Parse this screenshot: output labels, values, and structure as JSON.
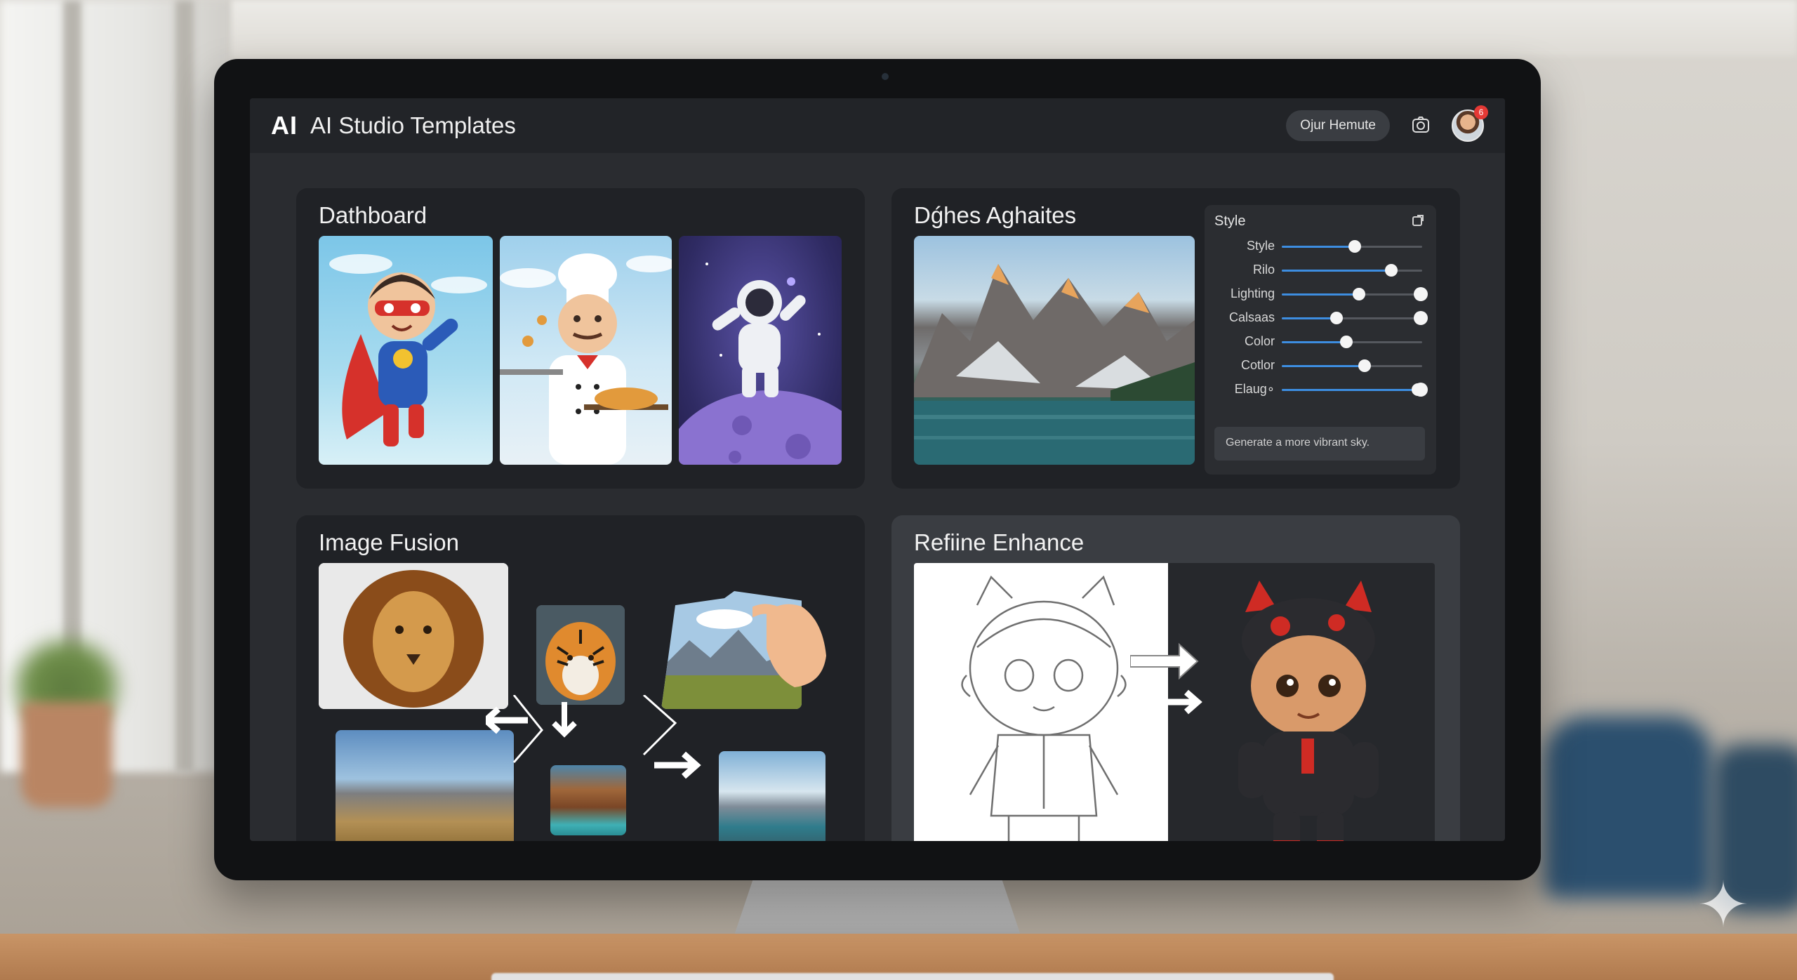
{
  "header": {
    "logo": "AI",
    "title": "AI Studio Templates",
    "user_label": "Ojur Hemute",
    "notification_count": "6",
    "icons": [
      "camera-icon",
      "avatar"
    ]
  },
  "cards": {
    "dashboard": {
      "title": "Dathboard"
    },
    "edit": {
      "title": "Dǵhes Aghaites",
      "panel_title": "Style",
      "sliders": [
        {
          "label": "Style",
          "value": 0.52,
          "end_knob": false
        },
        {
          "label": "Rilo",
          "value": 0.78,
          "end_knob": false
        },
        {
          "label": "Lighting",
          "value": 0.55,
          "end_knob": true
        },
        {
          "label": "Calsaas",
          "value": 0.39,
          "end_knob": true
        },
        {
          "label": "Color",
          "value": 0.46,
          "end_knob": false
        },
        {
          "label": "Cotlor",
          "value": 0.59,
          "end_knob": false
        },
        {
          "label": "Elaug∘",
          "value": 0.97,
          "end_knob": true
        }
      ],
      "prompt": "Generate a more vibrant sky."
    },
    "fusion": {
      "title": "Image Fusion"
    },
    "refine": {
      "title": "Refiine Enhance"
    }
  },
  "colors": {
    "accent": "#3d8de0",
    "screen_bg": "#2a2c30",
    "card_bg": "#202226",
    "notification": "#e53935"
  }
}
